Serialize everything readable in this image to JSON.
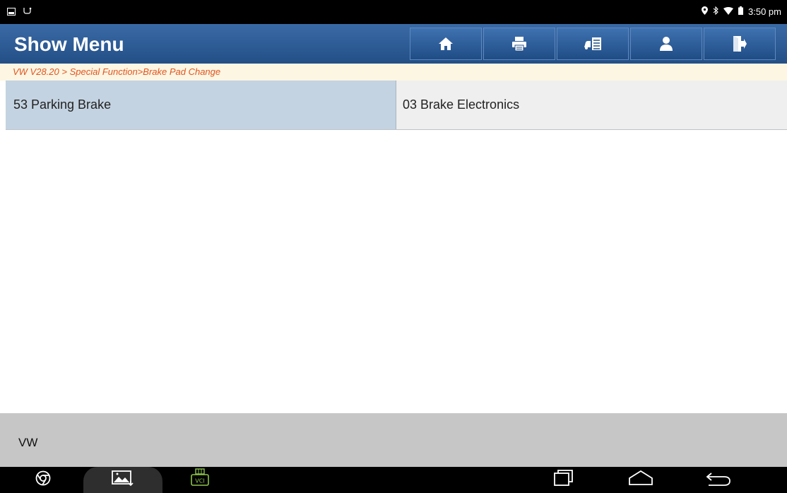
{
  "statusbar": {
    "time": "3:50 pm",
    "left_icons": [
      "image-icon",
      "usb-debug-icon"
    ],
    "right_icons": [
      "location-icon",
      "bluetooth-icon",
      "wifi-icon",
      "battery-icon"
    ]
  },
  "header": {
    "title": "Show Menu",
    "toolbar": [
      "home-icon",
      "print-icon",
      "vehicle-info-icon",
      "user-icon",
      "exit-icon"
    ]
  },
  "breadcrumb": "VW V28.20 > Special Function>Brake Pad Change",
  "menu": {
    "items": [
      {
        "label": "53 Parking Brake",
        "selected": true
      },
      {
        "label": "03 Brake Electronics",
        "selected": false
      }
    ]
  },
  "footer": {
    "label": "VW"
  },
  "navbar": {
    "vci_label": "VCI",
    "icons": [
      "chrome-icon",
      "gallery-icon",
      "vci-icon",
      "recents-icon",
      "home-nav-icon",
      "back-icon"
    ]
  },
  "colors": {
    "header_blue": "#234f86",
    "breadcrumb_text": "#e2541f",
    "selected_item": "#c4d3e1",
    "footer_gray": "#c6c6c6"
  }
}
